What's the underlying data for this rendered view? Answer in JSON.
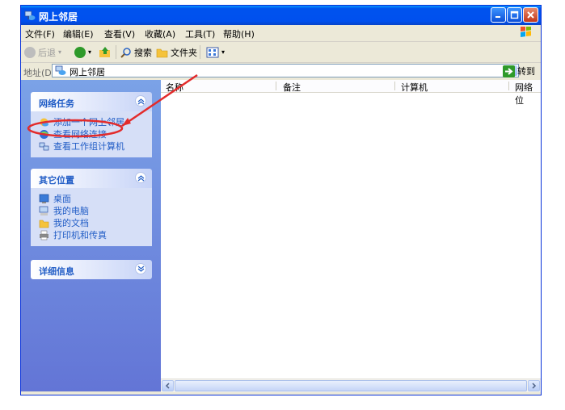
{
  "window": {
    "title": "网上邻居",
    "controls": [
      "minimize",
      "maximize",
      "close"
    ]
  },
  "menu": {
    "items": [
      "文件(F)",
      "编辑(E)",
      "查看(V)",
      "收藏(A)",
      "工具(T)",
      "帮助(H)"
    ]
  },
  "toolbar": {
    "back_label": "后退",
    "search_label": "搜索",
    "folders_label": "文件夹"
  },
  "address": {
    "label": "地址(D)",
    "value": "网上邻居",
    "go_label": "转到"
  },
  "left_panels": [
    {
      "title": "网络任务",
      "tasks": [
        {
          "label": "添加一个网上邻居",
          "icon": "add-network-place-icon"
        },
        {
          "label": "查看网络连接",
          "icon": "network-connections-icon"
        },
        {
          "label": "查看工作组计算机",
          "icon": "workgroup-computers-icon"
        }
      ]
    },
    {
      "title": "其它位置",
      "tasks": [
        {
          "label": "桌面",
          "icon": "desktop-icon"
        },
        {
          "label": "我的电脑",
          "icon": "my-computer-icon"
        },
        {
          "label": "我的文档",
          "icon": "my-documents-icon"
        },
        {
          "label": "打印机和传真",
          "icon": "printers-faxes-icon"
        }
      ]
    },
    {
      "title": "详细信息",
      "tasks": []
    }
  ],
  "file_list": {
    "columns": [
      "名称",
      "备注",
      "计算机",
      "网络位"
    ]
  },
  "colors": {
    "titlebar": "#0053ee",
    "task_pane": "#6c8de3",
    "task_link": "#215dc6",
    "annotation": "#e32b2b"
  }
}
